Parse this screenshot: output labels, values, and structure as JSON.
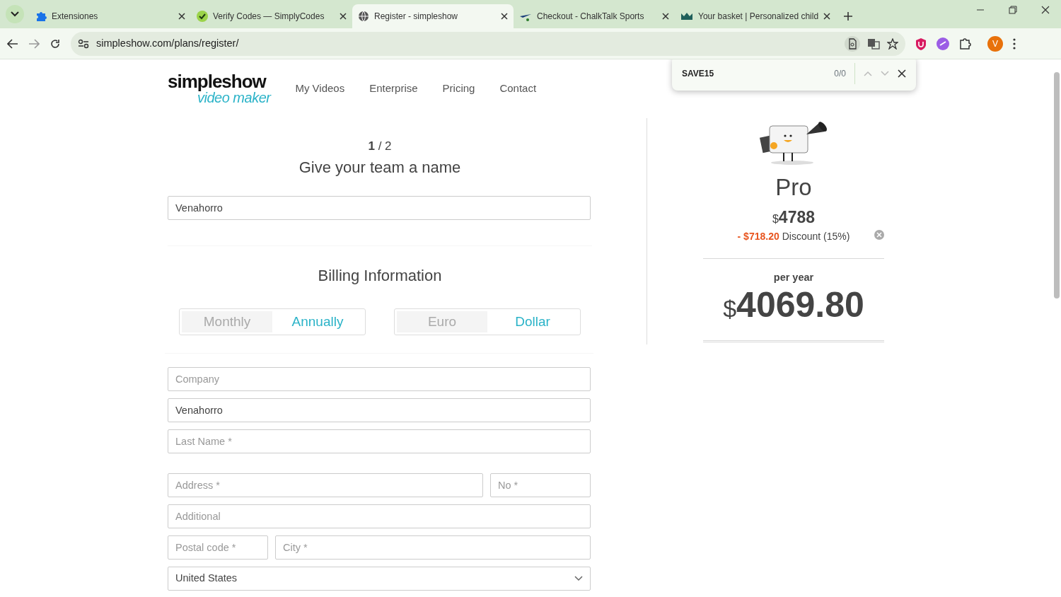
{
  "browser": {
    "tabs": [
      {
        "title": "Extensiones",
        "selected": false
      },
      {
        "title": "Verify Codes — SimplyCodes",
        "selected": false
      },
      {
        "title": "Register - simpleshow",
        "selected": true
      },
      {
        "title": "Checkout - ChalkTalk Sports",
        "selected": false
      },
      {
        "title": "Your basket | Personalized child",
        "selected": false
      }
    ],
    "address": "simpleshow.com/plans/register/",
    "profile_initial": "V",
    "find_bar": {
      "query": "SAVE15",
      "count": "0/0"
    }
  },
  "site": {
    "logo": {
      "line1": "simpleshow",
      "line2": "video maker"
    },
    "nav": [
      "My Videos",
      "Enterprise",
      "Pricing",
      "Contact"
    ]
  },
  "form": {
    "step": "**1** / 2",
    "team_heading": "Give your team a name",
    "team_name": "Venahorro",
    "billing_heading": "Billing Information",
    "toggles": [
      {
        "options": [
          {
            "label": "Monthly",
            "selected": false
          },
          {
            "label": "Annually",
            "selected": true
          }
        ]
      },
      {
        "options": [
          {
            "label": "Euro",
            "selected": false
          },
          {
            "label": "Dollar",
            "selected": true
          }
        ]
      }
    ],
    "field_rows": [
      [
        {
          "kind": "input",
          "placeholder": "Company"
        }
      ],
      [
        {
          "kind": "input",
          "value": "Venahorro"
        }
      ],
      [
        {
          "kind": "input",
          "placeholder": "Last Name *"
        }
      ],
      [
        {
          "kind": "input",
          "placeholder": "Address *"
        },
        {
          "kind": "input",
          "placeholder": "No *"
        }
      ],
      [
        {
          "kind": "input",
          "placeholder": "Additional"
        }
      ],
      [
        {
          "kind": "input",
          "placeholder": "Postal code *"
        },
        {
          "kind": "input",
          "placeholder": "City *"
        }
      ],
      [
        {
          "kind": "select",
          "value": "United States"
        }
      ]
    ]
  },
  "plan": {
    "name": "Pro",
    "price_currency": "$",
    "price": "4788",
    "discount_amount": "- $718.20",
    "discount_label": "Discount (15%)",
    "period": "per year",
    "total_currency": "$",
    "total": "4069.80"
  }
}
